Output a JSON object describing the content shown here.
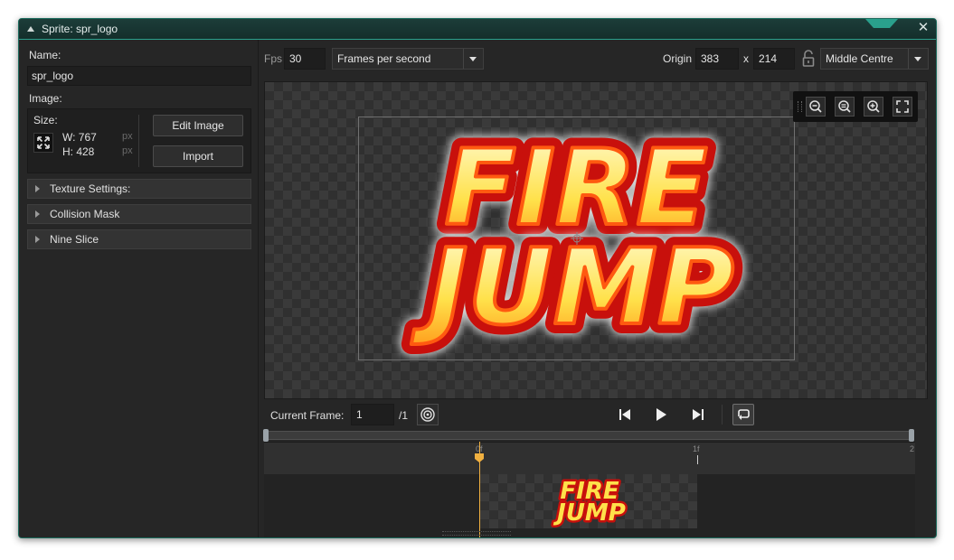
{
  "window": {
    "title": "Sprite: spr_logo"
  },
  "left_panel": {
    "name_label": "Name:",
    "name_value": "spr_logo",
    "image_label": "Image:",
    "size_label": "Size:",
    "width": "W: 767",
    "height": "H: 428",
    "unit": "px",
    "edit_image_label": "Edit Image",
    "import_label": "Import",
    "sections": [
      "Texture Settings:",
      "Collision Mask",
      "Nine Slice"
    ]
  },
  "toolbar": {
    "fps_label": "Fps",
    "fps_value": "30",
    "speed_type": "Frames per second",
    "origin_label": "Origin",
    "origin_x": "383",
    "origin_sep": "x",
    "origin_y": "214",
    "origin_preset": "Middle Centre"
  },
  "sprite": {
    "line1": "FIRE",
    "line2": "JUMP"
  },
  "playback": {
    "current_frame_label": "Current Frame:",
    "current_frame_value": "1",
    "frame_total": "/1"
  },
  "timeline": {
    "ticks": [
      "0f",
      "1f",
      "2"
    ]
  },
  "colors": {
    "accent": "#2aa08c",
    "playhead": "#f0b040"
  }
}
